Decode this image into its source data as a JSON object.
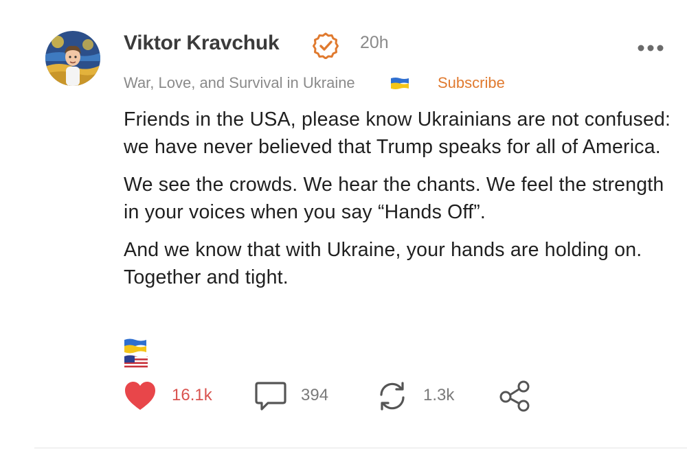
{
  "post": {
    "author_name": "Viktor Kravchuk",
    "timestamp": "20h",
    "publication": "War, Love, and Survival in Ukraine",
    "subscribe_label": "Subscribe",
    "paragraphs": [
      "Friends in the USA, please know Ukrainians are not confused: we have never believed that Trump speaks for all of America.",
      "We see the crowds. We hear the chants. We feel the strength in your voices when you say “Hands Off”.",
      "And we know that with Ukraine, your hands are holding on. Together and tight."
    ],
    "emoji_line": [
      "ukraine-flag",
      "usa-flag"
    ]
  },
  "actions": {
    "likes": "16.1k",
    "comments": "394",
    "restacks": "1.3k"
  },
  "icons": {
    "verified": "verified-check-icon",
    "more": "more-options-icon",
    "like": "heart-icon",
    "comment": "comment-bubble-icon",
    "restack": "restack-icon",
    "share": "share-icon"
  },
  "colors": {
    "accent": "#e07a2f",
    "like": "#e8464a",
    "muted": "#8a8a8a",
    "text": "#1f1f1f"
  }
}
